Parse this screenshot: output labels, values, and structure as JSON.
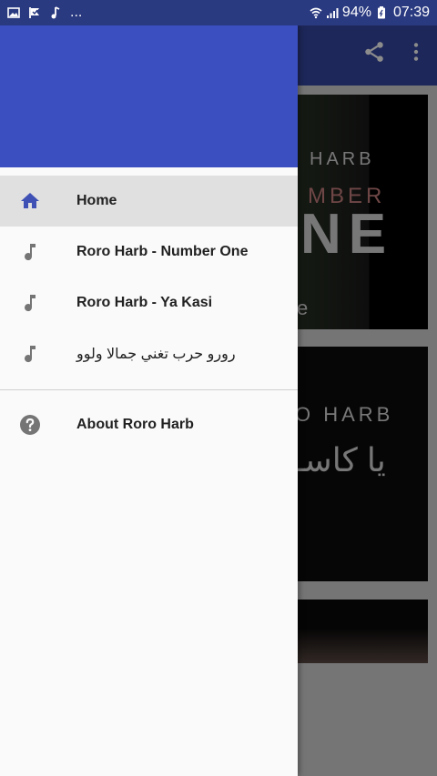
{
  "status_bar": {
    "notification_dots": "...",
    "battery": "94%",
    "time": "07:39",
    "icons": [
      "image-icon",
      "check-flag-icon",
      "music-note-icon",
      "wifi-icon",
      "signal-icon",
      "battery-icon"
    ]
  },
  "app_bar": {
    "actions": [
      "share-icon",
      "more-vert-icon"
    ]
  },
  "background_cards": {
    "card1_text_line1": "HARB",
    "card1_text_line2": "MBER",
    "card1_text_line3": "NE",
    "card1_text_line4": "e",
    "card2_text_line1": "O HARB",
    "card2_text_line2": "يا كاسـ"
  },
  "drawer": {
    "items": [
      {
        "label": "Home",
        "icon": "home-icon",
        "active": true
      },
      {
        "label": "Roro Harb - Number One",
        "icon": "music-note-icon"
      },
      {
        "label": "Roro Harb - Ya Kasi",
        "icon": "music-note-icon"
      },
      {
        "label": "رورو حرب تغني جمالا ولوو",
        "icon": "music-note-icon"
      }
    ],
    "secondary": [
      {
        "label": "About Roro Harb",
        "icon": "help-circle-icon"
      }
    ]
  },
  "colors": {
    "primary": "#3b4fc0",
    "primary_dark": "#2a3a80",
    "accent_active_icon": "#3f51b5"
  }
}
